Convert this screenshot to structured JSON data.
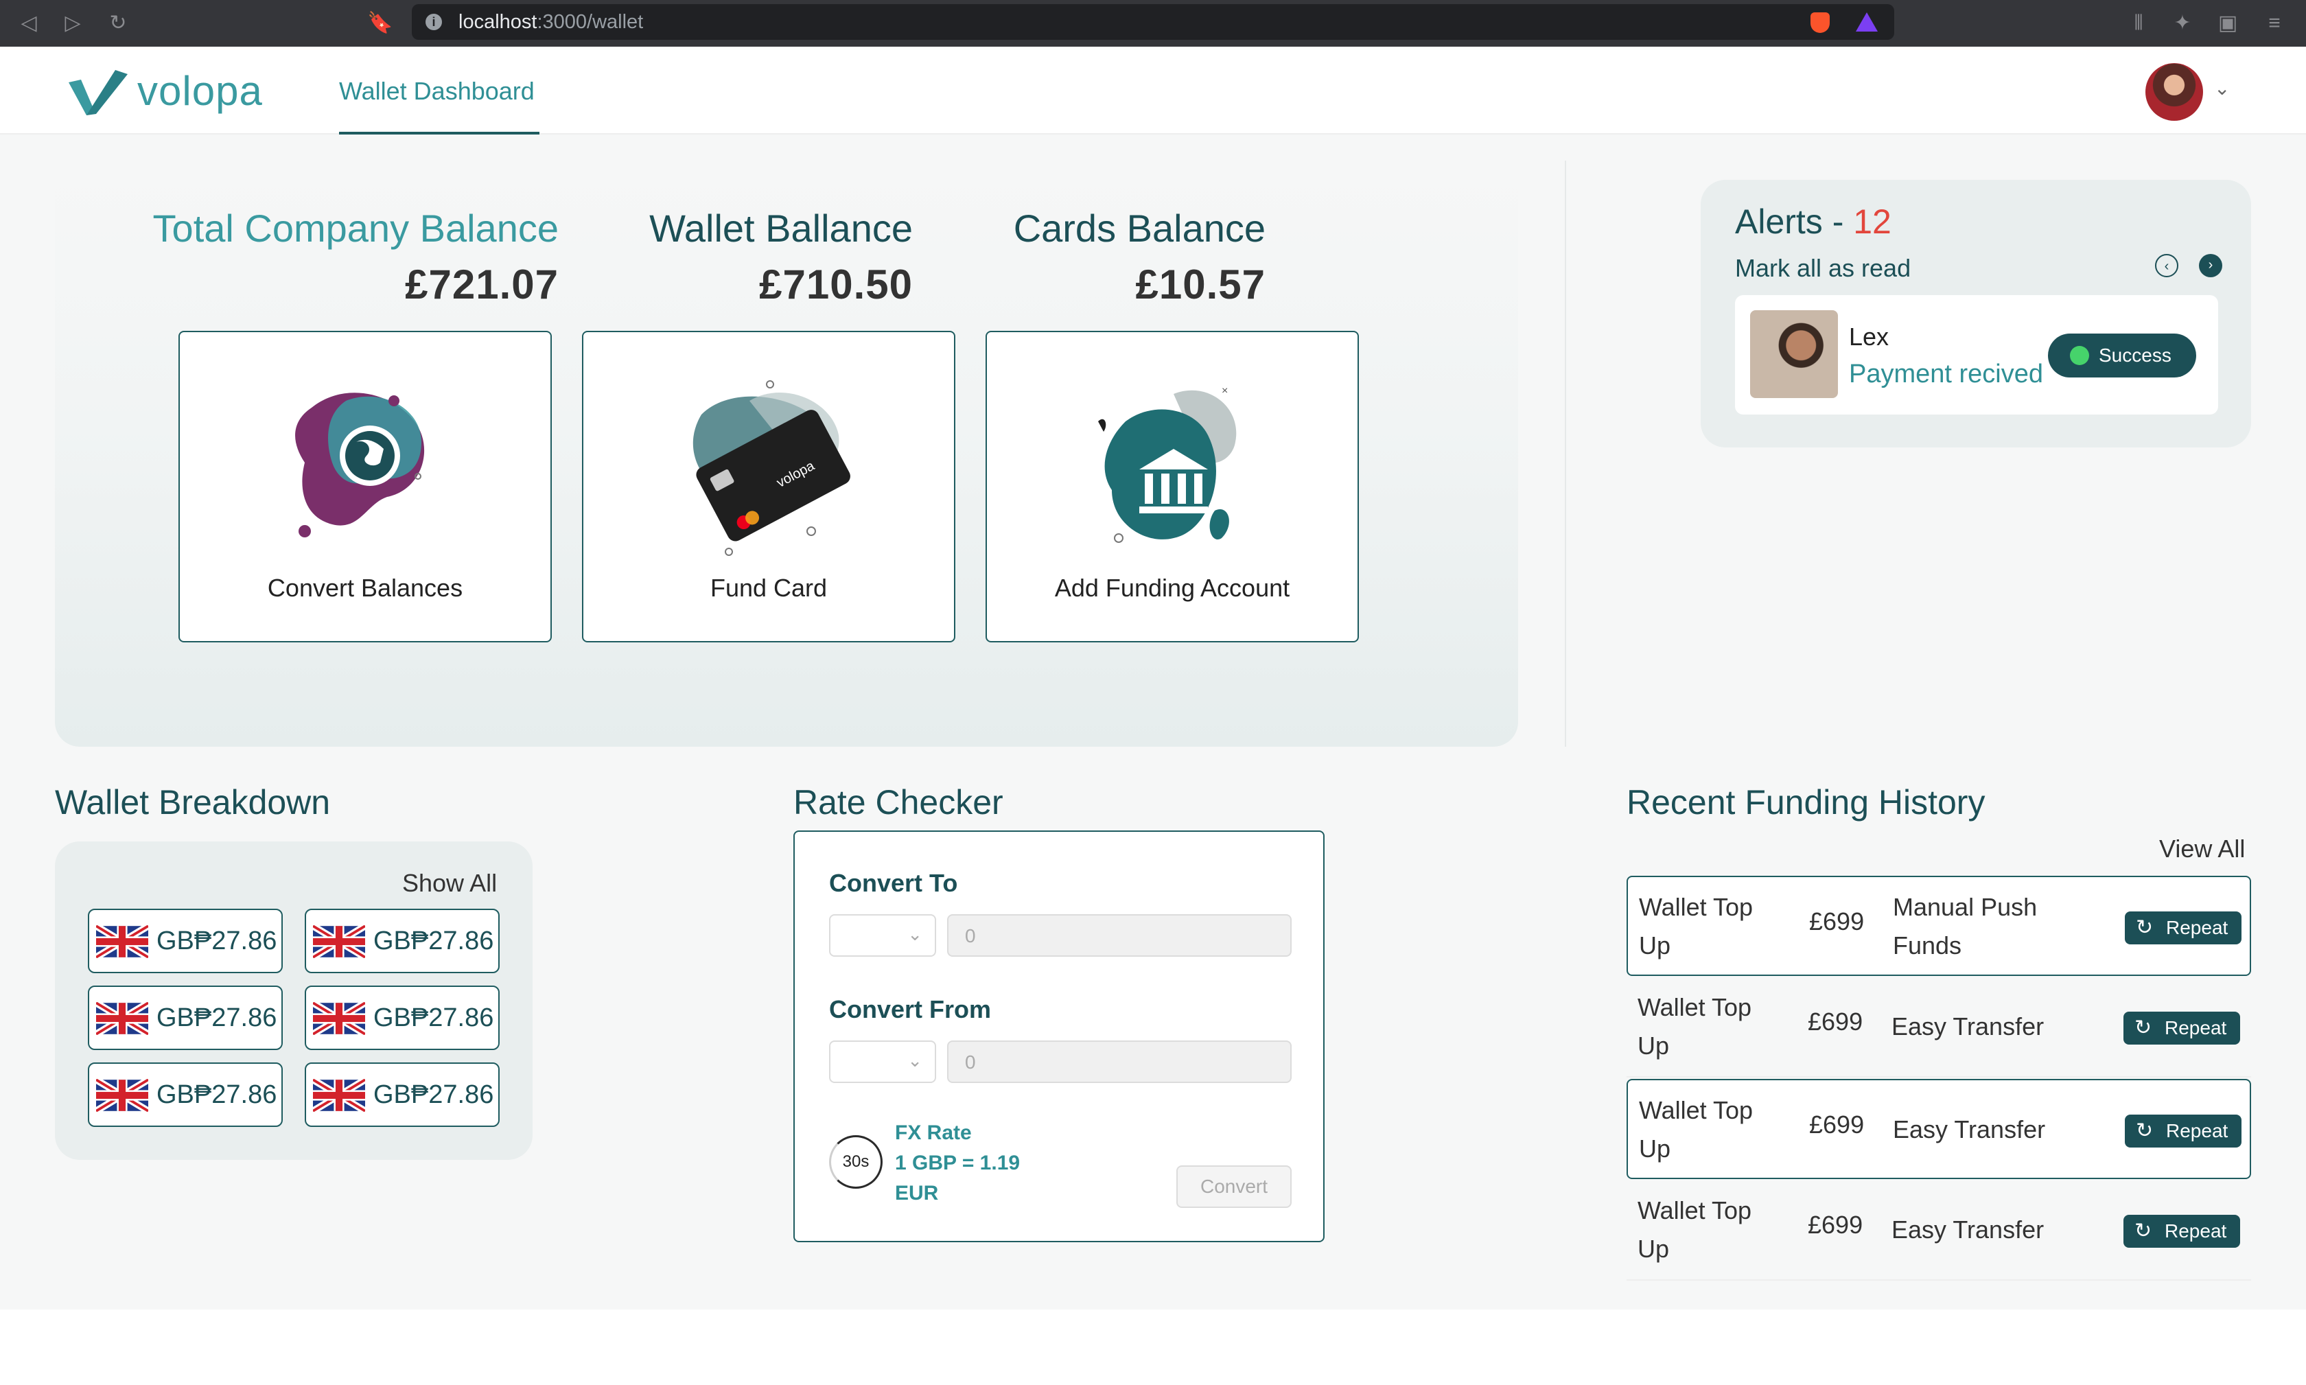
{
  "browser": {
    "url_host": "localhost",
    "url_path": ":3000/wallet"
  },
  "header": {
    "logo_text": "volopa",
    "nav_tab": "Wallet Dashboard"
  },
  "balances": {
    "total": {
      "title": "Total Company Balance",
      "amount": "£721.07"
    },
    "wallet": {
      "title": "Wallet Ballance",
      "amount": "£710.50"
    },
    "cards": {
      "title": "Cards Balance",
      "amount": "£10.57"
    }
  },
  "actions": [
    {
      "label": "Convert Balances",
      "icon": "globe-icon"
    },
    {
      "label": "Fund Card",
      "icon": "card-icon"
    },
    {
      "label": "Add Funding Account",
      "icon": "bank-icon"
    }
  ],
  "alerts": {
    "title": "Alerts - ",
    "count": "12",
    "mark_all": "Mark all as read",
    "item": {
      "name": "Lex",
      "message": "Payment recived",
      "status": "Success"
    }
  },
  "wallet_breakdown": {
    "title": "Wallet Breakdown",
    "show_all": "Show All",
    "items": [
      {
        "amount": "GB₱27.86"
      },
      {
        "amount": "GB₱27.86"
      },
      {
        "amount": "GB₱27.86"
      },
      {
        "amount": "GB₱27.86"
      },
      {
        "amount": "GB₱27.86"
      },
      {
        "amount": "GB₱27.86"
      }
    ]
  },
  "rate_checker": {
    "title": "Rate Checker",
    "convert_to_label": "Convert To",
    "convert_to_value": "0",
    "convert_from_label": "Convert From",
    "convert_from_value": "0",
    "timer": "30s",
    "fx_label": "FX Rate",
    "fx_line1": "1 GBP = 1.19",
    "fx_line2": "EUR",
    "convert_button": "Convert"
  },
  "funding_history": {
    "title": "Recent Funding History",
    "view_all": "View All",
    "repeat_label": "Repeat",
    "rows": [
      {
        "type": "Wallet Top Up",
        "amount": "£699",
        "method": "Manual Push Funds"
      },
      {
        "type": "Wallet Top Up",
        "amount": "£699",
        "method": "Easy Transfer"
      },
      {
        "type": "Wallet Top Up",
        "amount": "£699",
        "method": "Easy Transfer"
      },
      {
        "type": "Wallet Top Up",
        "amount": "£699",
        "method": "Easy Transfer"
      }
    ]
  },
  "colors": {
    "brand_teal": "#1c4f56",
    "accent_teal": "#2f8f95",
    "alert_red": "#e2463c",
    "success_green": "#46d36b"
  }
}
